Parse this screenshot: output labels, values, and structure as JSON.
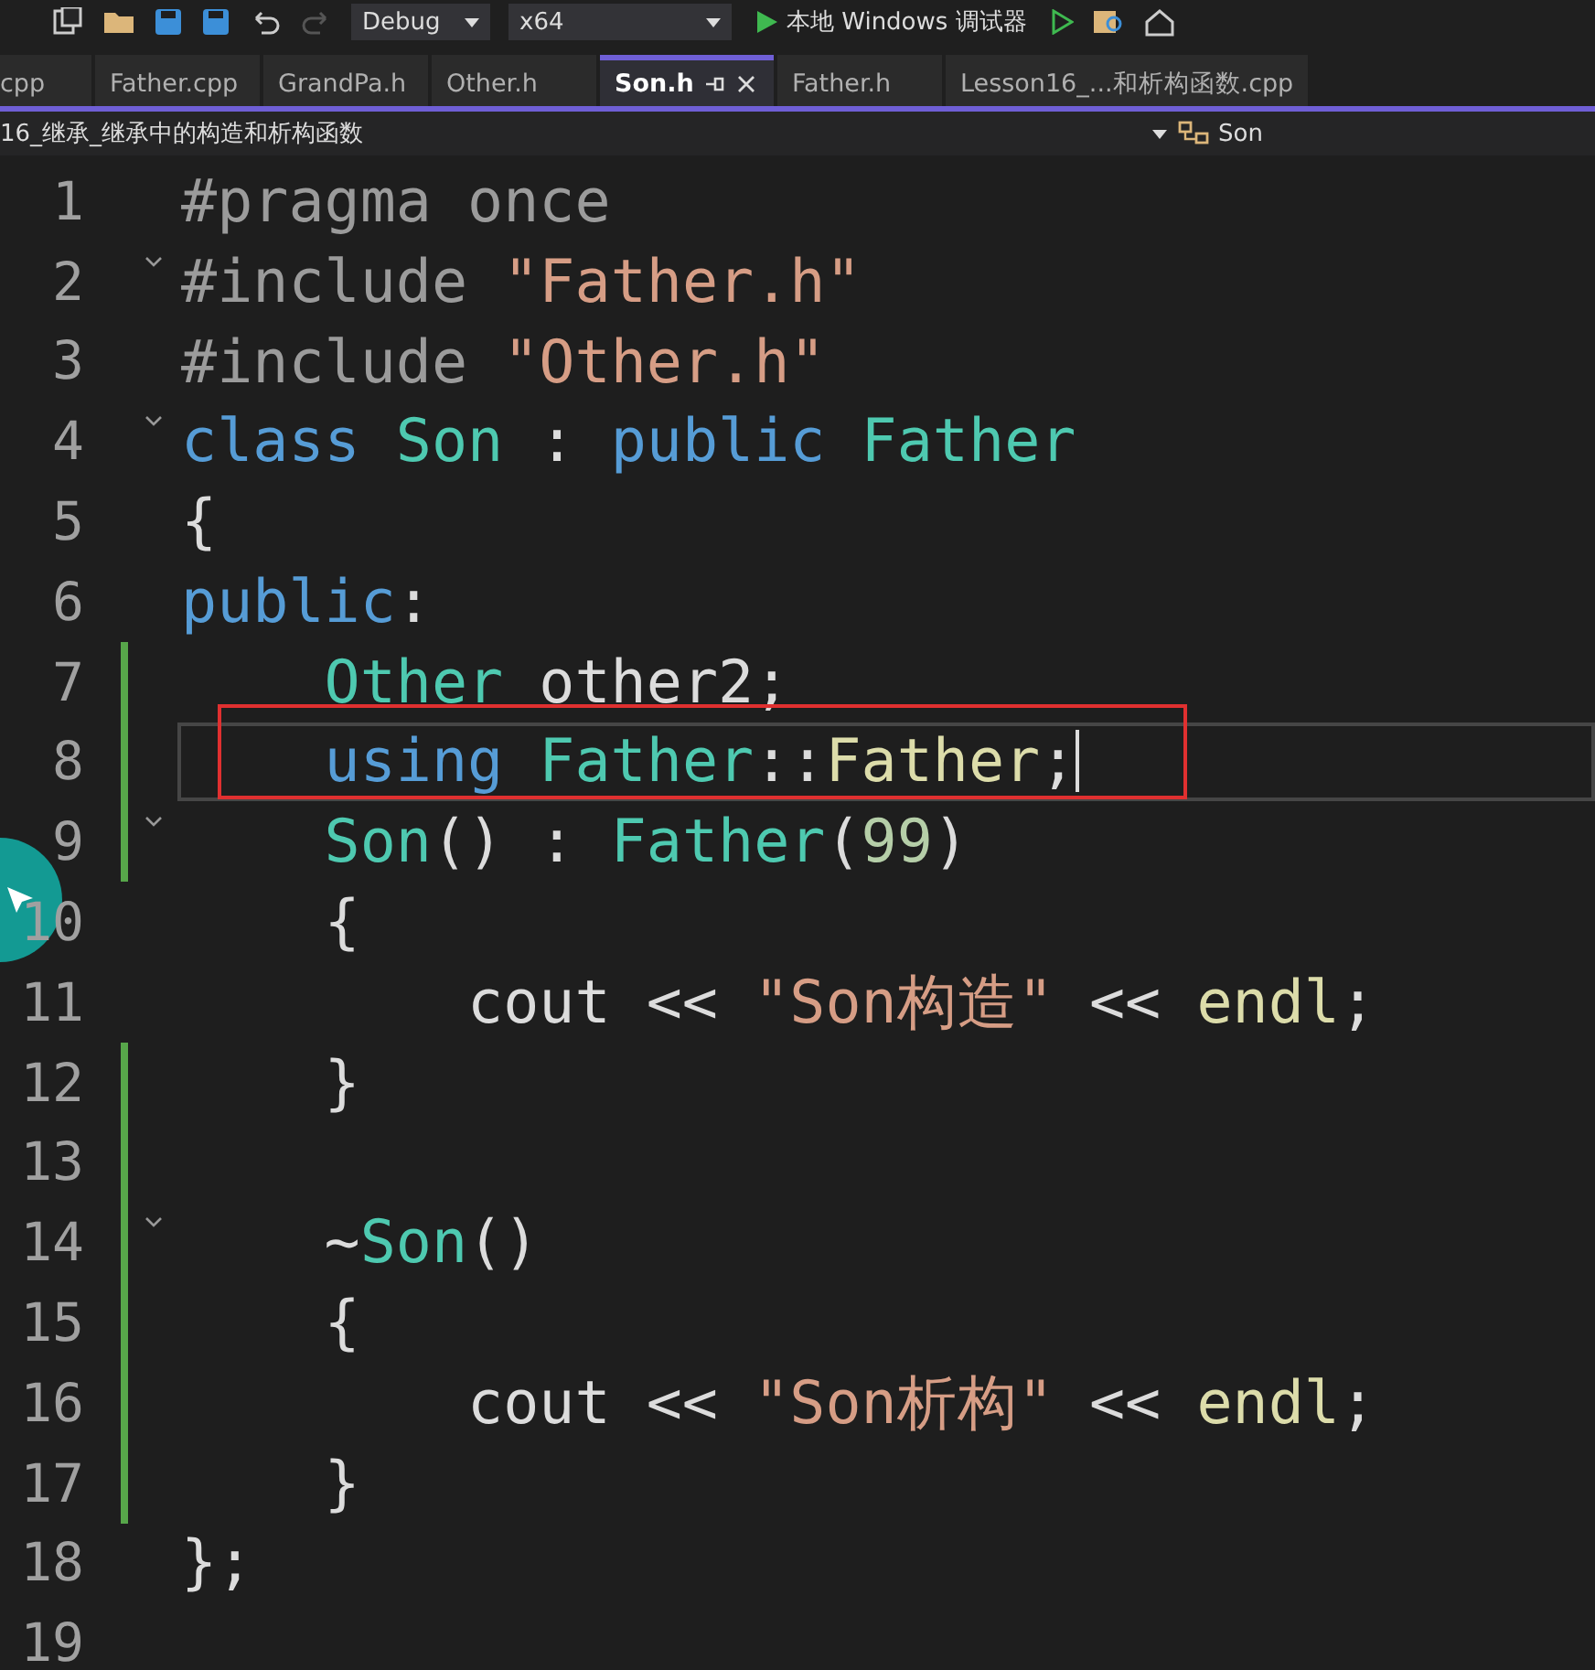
{
  "toolbar": {
    "config": "Debug",
    "platform": "x64",
    "run_label": "本地 Windows 调试器"
  },
  "tabs": [
    {
      "label": "cpp",
      "selected": false,
      "pinned": false
    },
    {
      "label": "Father.cpp",
      "selected": false,
      "pinned": false
    },
    {
      "label": "GrandPa.h",
      "selected": false,
      "pinned": false
    },
    {
      "label": "Other.h",
      "selected": false,
      "pinned": false
    },
    {
      "label": "Son.h",
      "selected": true,
      "pinned": true
    },
    {
      "label": "Father.h",
      "selected": false,
      "pinned": false
    },
    {
      "label": "Lesson16_...和析构函数.cpp",
      "selected": false,
      "pinned": false
    }
  ],
  "nav_bar": {
    "project": "16_继承_继承中的构造和析构函数",
    "member": "Son"
  },
  "editor": {
    "lines": [
      {
        "number": "1",
        "fold": false,
        "changed": false,
        "current": false,
        "boxed": false,
        "tokens": [
          {
            "kind": "pre",
            "text": "#pragma once"
          }
        ]
      },
      {
        "number": "2",
        "fold": true,
        "changed": false,
        "current": false,
        "boxed": false,
        "tokens": [
          {
            "kind": "pre",
            "text": "#include"
          },
          {
            "kind": "str",
            "text": " \"Father.h\""
          }
        ]
      },
      {
        "number": "3",
        "fold": false,
        "changed": false,
        "current": false,
        "boxed": false,
        "tokens": [
          {
            "kind": "pre",
            "text": "#include"
          },
          {
            "kind": "str",
            "text": " \"Other.h\""
          }
        ]
      },
      {
        "number": "4",
        "fold": true,
        "changed": false,
        "current": false,
        "boxed": false,
        "tokens": [
          {
            "kind": "kw",
            "text": "class"
          },
          {
            "kind": "type",
            "text": " Son"
          },
          {
            "kind": "plain",
            "text": " : "
          },
          {
            "kind": "kw",
            "text": "public"
          },
          {
            "kind": "type",
            "text": " Father"
          }
        ]
      },
      {
        "number": "5",
        "fold": false,
        "changed": false,
        "current": false,
        "boxed": false,
        "tokens": [
          {
            "kind": "plain",
            "text": "{"
          }
        ]
      },
      {
        "number": "6",
        "fold": false,
        "changed": false,
        "current": false,
        "boxed": false,
        "tokens": [
          {
            "kind": "kw",
            "text": "public"
          },
          {
            "kind": "plain",
            "text": ":"
          }
        ]
      },
      {
        "number": "7",
        "fold": false,
        "changed": true,
        "current": false,
        "boxed": false,
        "tokens": [
          {
            "kind": "type",
            "text": "    Other"
          },
          {
            "kind": "plain",
            "text": " other2;"
          }
        ]
      },
      {
        "number": "8",
        "fold": false,
        "changed": true,
        "current": true,
        "boxed": true,
        "tokens": [
          {
            "kind": "kw",
            "text": "    using"
          },
          {
            "kind": "type",
            "text": " Father"
          },
          {
            "kind": "plain",
            "text": "::"
          },
          {
            "kind": "fn",
            "text": "Father"
          },
          {
            "kind": "plain",
            "text": ";"
          }
        ]
      },
      {
        "number": "9",
        "fold": true,
        "changed": true,
        "current": false,
        "boxed": false,
        "tokens": [
          {
            "kind": "type",
            "text": "    Son"
          },
          {
            "kind": "plain",
            "text": "() : "
          },
          {
            "kind": "type",
            "text": "Father"
          },
          {
            "kind": "plain",
            "text": "("
          },
          {
            "kind": "num",
            "text": "99"
          },
          {
            "kind": "plain",
            "text": ")"
          }
        ]
      },
      {
        "number": "10",
        "fold": false,
        "changed": false,
        "current": false,
        "boxed": false,
        "tokens": [
          {
            "kind": "plain",
            "text": "    {"
          }
        ]
      },
      {
        "number": "11",
        "fold": false,
        "changed": false,
        "current": false,
        "boxed": false,
        "tokens": [
          {
            "kind": "plain",
            "text": "        cout << "
          },
          {
            "kind": "str",
            "text": "\"Son构造\""
          },
          {
            "kind": "plain",
            "text": " << "
          },
          {
            "kind": "fn",
            "text": "endl"
          },
          {
            "kind": "plain",
            "text": ";"
          }
        ]
      },
      {
        "number": "12",
        "fold": false,
        "changed": true,
        "current": false,
        "boxed": false,
        "tokens": [
          {
            "kind": "plain",
            "text": "    }"
          }
        ]
      },
      {
        "number": "13",
        "fold": false,
        "changed": true,
        "current": false,
        "boxed": false
      },
      {
        "number": "14",
        "fold": true,
        "changed": true,
        "current": false,
        "boxed": false,
        "tokens": [
          {
            "kind": "plain",
            "text": "    ~"
          },
          {
            "kind": "type",
            "text": "Son"
          },
          {
            "kind": "plain",
            "text": "()"
          }
        ]
      },
      {
        "number": "15",
        "fold": false,
        "changed": true,
        "current": false,
        "boxed": false,
        "tokens": [
          {
            "kind": "plain",
            "text": "    {"
          }
        ]
      },
      {
        "number": "16",
        "fold": false,
        "changed": true,
        "current": false,
        "boxed": false,
        "tokens": [
          {
            "kind": "plain",
            "text": "        cout << "
          },
          {
            "kind": "str",
            "text": "\"Son析构\""
          },
          {
            "kind": "plain",
            "text": " << "
          },
          {
            "kind": "fn",
            "text": "endl"
          },
          {
            "kind": "plain",
            "text": ";"
          }
        ]
      },
      {
        "number": "17",
        "fold": false,
        "changed": true,
        "current": false,
        "boxed": false,
        "tokens": [
          {
            "kind": "plain",
            "text": "    }"
          }
        ]
      },
      {
        "number": "18",
        "fold": false,
        "changed": false,
        "current": false,
        "boxed": false,
        "tokens": [
          {
            "kind": "plain",
            "text": "};"
          }
        ]
      },
      {
        "number": "19",
        "fold": false,
        "changed": false,
        "current": false,
        "boxed": false
      }
    ]
  }
}
